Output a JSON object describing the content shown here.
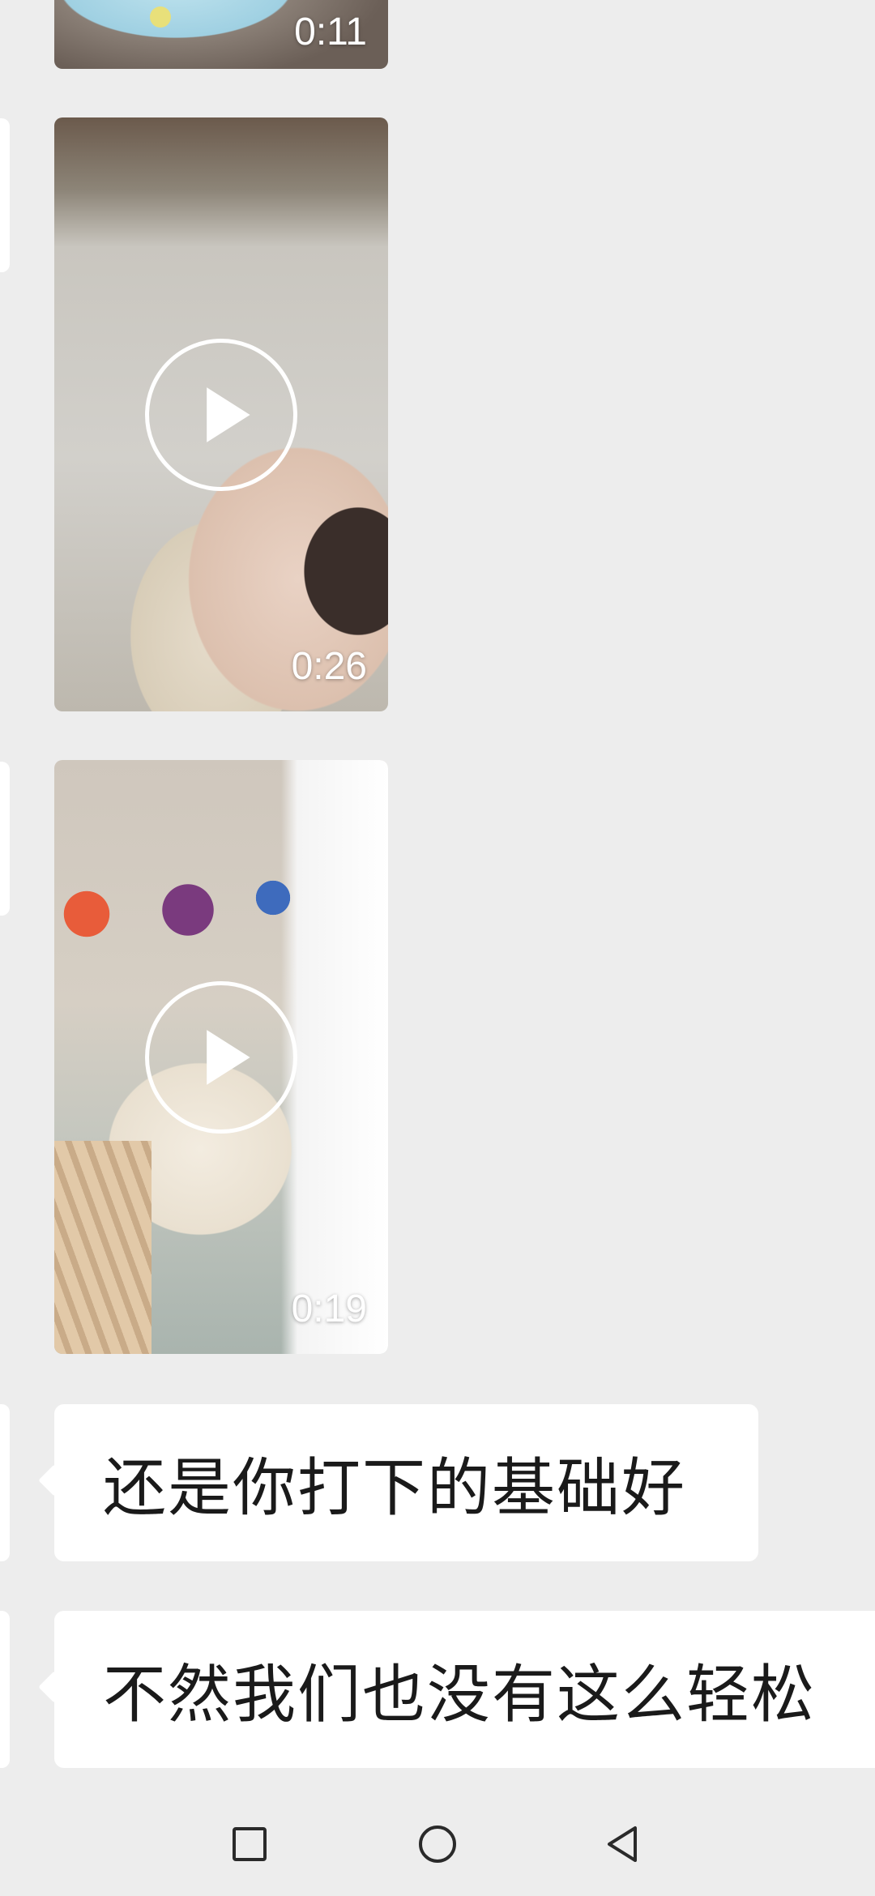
{
  "messages": [
    {
      "type": "video",
      "duration": "0:11",
      "thumbnail": "baby-bath-video"
    },
    {
      "type": "video",
      "duration": "0:26",
      "thumbnail": "baby-on-bed-video"
    },
    {
      "type": "video",
      "duration": "0:19",
      "thumbnail": "baby-in-crib-video"
    },
    {
      "type": "text",
      "text": "还是你打下的基础好"
    },
    {
      "type": "text",
      "text": "不然我们也没有这么轻松"
    }
  ],
  "navbar": {
    "buttons": [
      "recents-icon",
      "home-icon",
      "back-icon"
    ]
  },
  "colors": {
    "background": "#ededed",
    "bubble": "#ffffff",
    "text": "#1a1a1a"
  }
}
